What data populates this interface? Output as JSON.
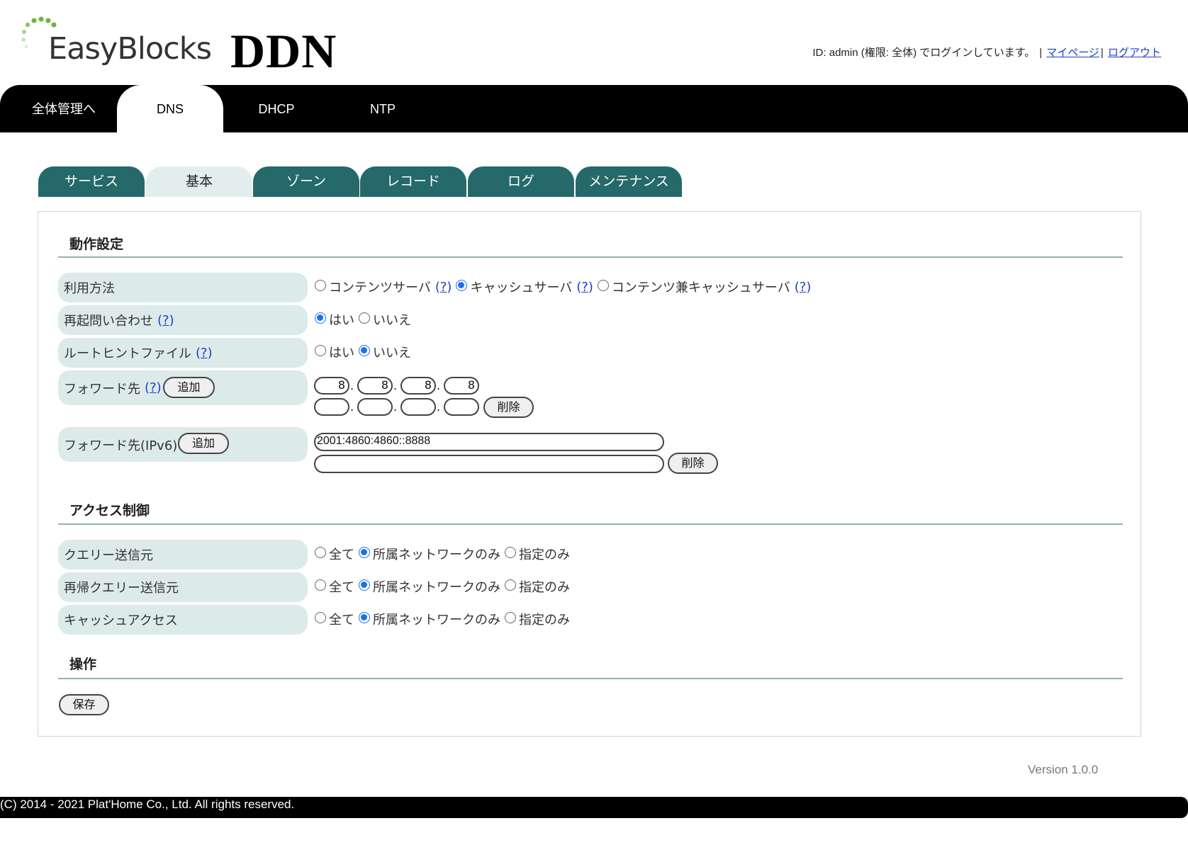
{
  "header": {
    "logo_text": "EasyBlocks",
    "app_title": "DDN",
    "login_status": "ID: admin (権限: 全体) でログインしています。",
    "mypage_link": "マイページ",
    "logout_link": "ログアウト"
  },
  "top_nav": [
    {
      "label": "全体管理へ",
      "active": false
    },
    {
      "label": "DNS",
      "active": true
    },
    {
      "label": "DHCP",
      "active": false
    },
    {
      "label": "NTP",
      "active": false
    }
  ],
  "sub_tabs": [
    {
      "label": "サービス",
      "active": false
    },
    {
      "label": "基本",
      "active": true
    },
    {
      "label": "ゾーン",
      "active": false
    },
    {
      "label": "レコード",
      "active": false
    },
    {
      "label": "ログ",
      "active": false
    },
    {
      "label": "メンテナンス",
      "active": false
    }
  ],
  "help_mark": "?",
  "sections": {
    "operation_settings": "動作設定",
    "access_control": "アクセス制御",
    "operations": "操作"
  },
  "usage": {
    "label": "利用方法",
    "options": [
      "コンテンツサーバ",
      "キャッシュサーバ",
      "コンテンツ兼キャッシュサーバ"
    ],
    "selected": "キャッシュサーバ"
  },
  "recursive_query": {
    "label": "再起問い合わせ",
    "options": [
      "はい",
      "いいえ"
    ],
    "selected": "はい"
  },
  "root_hint": {
    "label": "ルートヒントファイル",
    "options": [
      "はい",
      "いいえ"
    ],
    "selected": "いいえ"
  },
  "forwarders": {
    "label": "フォワード先",
    "add_button": "追加",
    "delete_button": "削除",
    "row1": [
      "8",
      "8",
      "8",
      "8"
    ],
    "row2": [
      "",
      "",
      "",
      ""
    ]
  },
  "forwarders_ipv6": {
    "label": "フォワード先(IPv6)",
    "add_button": "追加",
    "delete_button": "削除",
    "row1": "2001:4860:4860::8888",
    "row2": ""
  },
  "access_options": [
    "全て",
    "所属ネットワークのみ",
    "指定のみ"
  ],
  "query_source": {
    "label": "クエリー送信元",
    "selected": "所属ネットワークのみ"
  },
  "recursive_query_source": {
    "label": "再帰クエリー送信元",
    "selected": "所属ネットワークのみ"
  },
  "cache_access": {
    "label": "キャッシュアクセス",
    "selected": "所属ネットワークのみ"
  },
  "save_button": "保存",
  "version": "Version 1.0.0",
  "copyright": "(C) 2014 - 2021 Plat'Home Co., Ltd. All rights reserved.",
  "colors": {
    "tab_teal": "#25696b",
    "label_bg": "#dcebea",
    "link": "#1a3fcc",
    "radio_on": "#1a73e8"
  }
}
